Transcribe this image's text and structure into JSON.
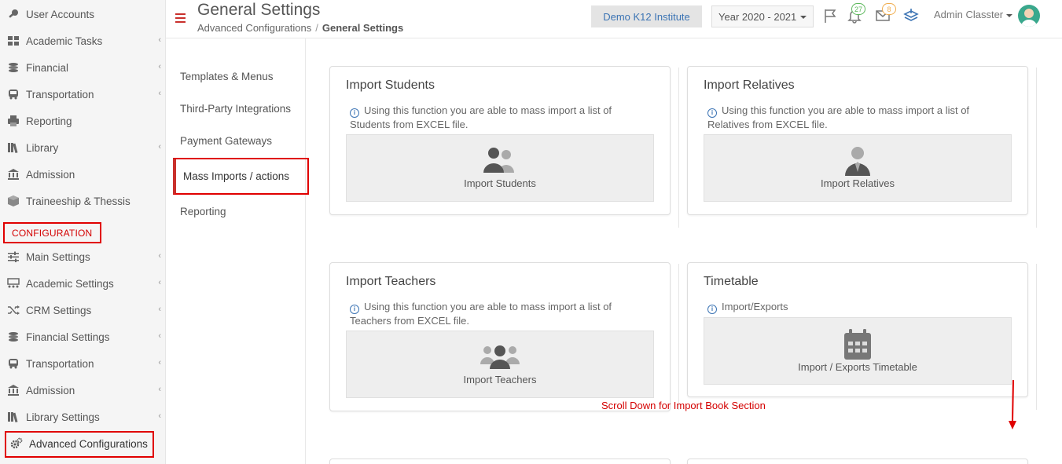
{
  "sidebar": {
    "items": [
      {
        "label": "User Accounts",
        "icon": "key-icon"
      },
      {
        "label": "Academic Tasks",
        "icon": "grid-icon"
      },
      {
        "label": "Financial",
        "icon": "coins-icon"
      },
      {
        "label": "Transportation",
        "icon": "bus-icon"
      },
      {
        "label": "Reporting",
        "icon": "printer-icon"
      },
      {
        "label": "Library",
        "icon": "books-icon"
      },
      {
        "label": "Admission",
        "icon": "institution-icon"
      },
      {
        "label": "Traineeship & Thessis",
        "icon": "box-icon"
      }
    ],
    "section_label": "CONFIGURATION",
    "config_items": [
      {
        "label": "Main Settings",
        "icon": "sliders-icon"
      },
      {
        "label": "Academic Settings",
        "icon": "classroom-icon"
      },
      {
        "label": "CRM Settings",
        "icon": "shuffle-icon"
      },
      {
        "label": "Financial Settings",
        "icon": "coins-icon"
      },
      {
        "label": "Transportation",
        "icon": "bus-icon"
      },
      {
        "label": "Admission",
        "icon": "institution-icon"
      },
      {
        "label": "Library Settings",
        "icon": "books-icon"
      },
      {
        "label": "Advanced Configurations",
        "icon": "gears-icon"
      }
    ]
  },
  "header": {
    "title": "General Settings",
    "breadcrumb": {
      "parent": "Advanced Configurations",
      "separator": "/",
      "current": "General Settings"
    },
    "institute": "Demo K12 Institute",
    "year": "Year 2020 - 2021",
    "notifications_count": "27",
    "messages_count": "8",
    "user_name": "Admin Classter"
  },
  "submenu": {
    "items": [
      "Templates & Menus",
      "Third-Party Integrations",
      "Payment Gateways",
      "Mass Imports / actions",
      "Reporting"
    ],
    "active": "Mass Imports / actions"
  },
  "cards": [
    {
      "title": "Import Students",
      "info": "Using this function you are able to mass import a list of Students from EXCEL file.",
      "tile_label": "Import Students"
    },
    {
      "title": "Import Relatives",
      "info": "Using this function you are able to mass import a list of Relatives from EXCEL file.",
      "tile_label": "Import Relatives"
    },
    {
      "title": "Import Teachers",
      "info": "Using this function you are able to mass import a list of Teachers from EXCEL file.",
      "tile_label": "Import Teachers"
    },
    {
      "title": "Timetable",
      "info": "Import/Exports",
      "tile_label": "Import / Exports Timetable"
    }
  ],
  "annotation": "Scroll Down for Import Book Section",
  "colors": {
    "accent_red": "#e00000",
    "link_blue": "#3c74b4",
    "avatar_green": "#3aa88d"
  }
}
